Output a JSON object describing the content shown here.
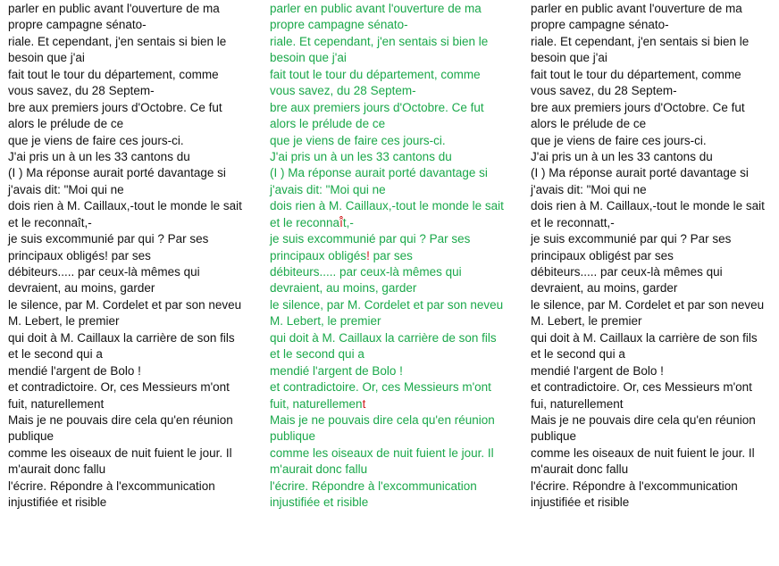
{
  "columns": {
    "left": [
      "parler en public avant l'ouverture de ma",
      "propre campagne sénato-",
      "riale. Et cependant, j'en sentais si bien le",
      "besoin que j'ai",
      "fait tout le tour du département, comme",
      "vous savez, du 28 Septem-",
      "bre aux premiers jours d'Octobre. Ce fut",
      "alors le prélude de ce",
      "que je viens de faire ces jours-ci.",
      "J'ai pris un à un les 33 cantons du",
      "(I ) Ma réponse aurait porté davantage si",
      "j'avais dit: \"Moi qui ne",
      "dois rien à M. Caillaux,-tout le monde le sait",
      "et le reconnaît,-",
      "je suis excommunié par qui ? Par ses",
      "principaux obligés! par ses",
      "débiteurs..... par ceux-là mêmes qui",
      "devraient, au moins, garder",
      "le silence, par M. Cordelet et par son neveu",
      "M. Lebert, le premier",
      "qui doit à M. Caillaux la carrière de son fils",
      "et le second qui a",
      "mendié l'argent de Bolo !",
      "et contradictoire. Or, ces Messieurs m'ont",
      "fuit, naturellement",
      "Mais je ne pouvais dire cela qu'en réunion",
      "publique",
      "comme les oiseaux de nuit fuient le jour. Il",
      "m'aurait donc fallu",
      "l'écrire. Répondre à l'excommunication",
      "injustifiée et risible"
    ],
    "middle": [
      "parler en public avant l'ouverture de ma",
      "propre campagne sénato-",
      "riale. Et cependant, j'en sentais si bien le",
      "besoin que j'ai",
      "fait tout le tour du département, comme",
      "vous savez, du 28 Septem-",
      "bre aux premiers jours d'Octobre. Ce fut",
      "alors le prélude de ce",
      "que je viens de faire ces jours-ci.",
      "J'ai pris un à un les 33 cantons du",
      "(I ) Ma réponse aurait porté davantage si",
      "j'avais dit: \"Moi qui ne",
      "dois rien à M. Caillaux,-tout le monde le sait",
      "et le reconnaî̂t,-",
      "je suis excommunié par qui ? Par ses",
      "principaux obligés! par ses",
      "débiteurs..... par ceux-là mêmes qui",
      "devraient, au moins, garder",
      "le silence, par M. Cordelet et par son neveu",
      "M. Lebert, le premier",
      "qui doit à M. Caillaux la carrière de son fils",
      "et le second qui a",
      "mendié l'argent de Bolo !",
      "et contradictoire. Or, ces Messieurs m'ont",
      "fuit, naturellement",
      "Mais je ne pouvais dire cela qu'en réunion",
      "publique",
      "comme les oiseaux de nuit fuient le jour. Il",
      "m'aurait donc fallu",
      "l'écrire. Répondre à l'excommunication",
      "injustifiée et risible"
    ],
    "right": [
      "parler en public avant l'ouverture de ma",
      "propre campagne sénato-",
      "riale. Et cependant, j'en sentais si bien le",
      "besoin que j'ai",
      "fait tout le tour du département, comme",
      "vous savez, du 28 Septem-",
      "bre aux premiers jours d'Octobre. Ce fut",
      "alors le prélude de ce",
      "que je viens de faire ces jours-ci.",
      "J'ai pris un à un les 33 cantons du",
      "(I ) Ma réponse aurait porté davantage si",
      "j'avais dit: \"Moi qui ne",
      "dois rien à M. Caillaux,-tout le monde le sait",
      "et le reconnatt,-",
      "je suis excommunié par qui ? Par ses",
      "principaux obligést par ses",
      "débiteurs..... par ceux-là mêmes qui",
      "devraient, au moins, garder",
      "le silence, par M. Cordelet et par son neveu",
      "M. Lebert, le premier",
      "qui doit à M. Caillaux la carrière de son fils",
      "et le second qui a",
      "mendié l'argent de Bolo !",
      "et contradictoire. Or, ces Messieurs m'ont",
      "fui, naturellement",
      "Mais je ne pouvais dire cela qu'en réunion",
      "publique",
      "comme les oiseaux de nuit fuient le jour. Il",
      "m'aurait donc fallu",
      "l'écrire. Répondre à l'excommunication",
      "injustifiée et risible"
    ]
  },
  "diff_marks": [
    {
      "column": "middle",
      "line": 13,
      "text": "î̂"
    },
    {
      "column": "middle",
      "line": 15,
      "text": "!"
    },
    {
      "column": "middle",
      "line": 24,
      "text": "t"
    }
  ],
  "colors": {
    "text_default": "#111111",
    "text_middle": "#1aa84a",
    "diff_highlight": "#d01a1a",
    "background": "#ffffff"
  }
}
